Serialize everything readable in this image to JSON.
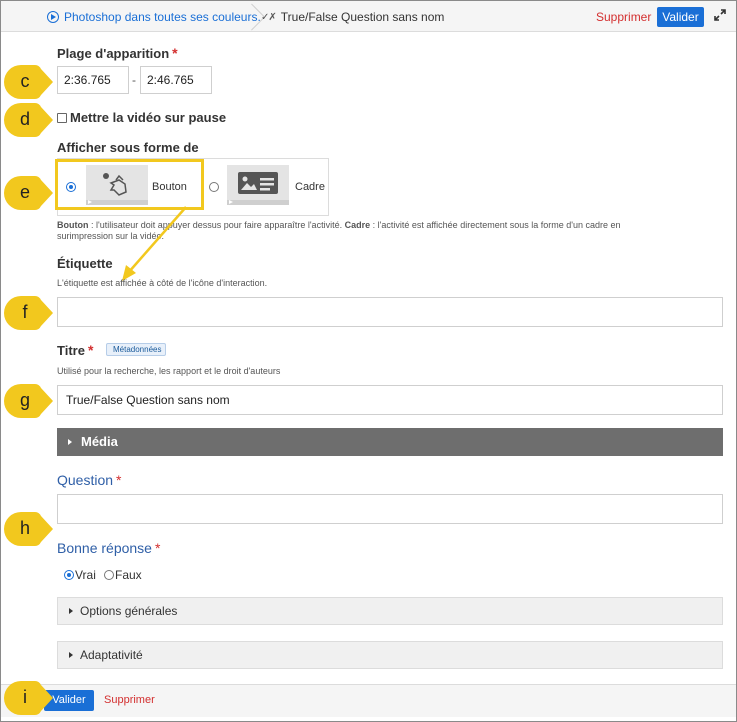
{
  "topbar": {
    "video_link": "Photoshop dans toutes ses couleurs.",
    "current": "True/False Question sans nom",
    "delete_label": "Supprimer",
    "validate_label": "Valider"
  },
  "display_range": {
    "label": "Plage d'apparition",
    "required": "*",
    "start": "2:36.765",
    "separator": "-",
    "end": "2:46.765"
  },
  "pause": {
    "label": "Mettre la vidéo sur pause"
  },
  "display_as": {
    "label": "Afficher sous forme de",
    "options": [
      {
        "label": "Bouton",
        "selected": true
      },
      {
        "label": "Cadre",
        "selected": false
      }
    ],
    "help_bold_1": "Bouton",
    "help_text_1": " : l'utilisateur doit appuyer dessus pour faire apparaître l'activité. ",
    "help_bold_2": "Cadre",
    "help_text_2": " : l'activité est affichée directement sous la forme d'un cadre en",
    "help_text_3": "surimpression sur la vidéo."
  },
  "etiquette": {
    "label": "Étiquette",
    "help": "L'étiquette est affichée à côté de l'icône d'interaction.",
    "value": ""
  },
  "titre": {
    "label": "Titre",
    "required": "*",
    "badge": "Métadonnées",
    "help": "Utilisé pour la recherche, les rapport et le droit d'auteurs",
    "value": "True/False Question sans nom"
  },
  "media": {
    "label": "Média"
  },
  "question": {
    "label": "Question",
    "required": "*",
    "value": ""
  },
  "answer": {
    "label": "Bonne réponse",
    "required": "*",
    "options": [
      {
        "label": "Vrai",
        "selected": true
      },
      {
        "label": "Faux",
        "selected": false
      }
    ]
  },
  "sections": {
    "general": "Options générales",
    "adaptive": "Adaptativité"
  },
  "bottombar": {
    "validate_label": "Valider",
    "delete_label": "Supprimer"
  },
  "callouts": [
    "c",
    "d",
    "e",
    "f",
    "g",
    "h",
    "i"
  ],
  "colors": {
    "accent": "#1a6fd6",
    "danger": "#d32f2f",
    "callout": "#f2c81e",
    "media_bar": "#6e6e6e"
  }
}
